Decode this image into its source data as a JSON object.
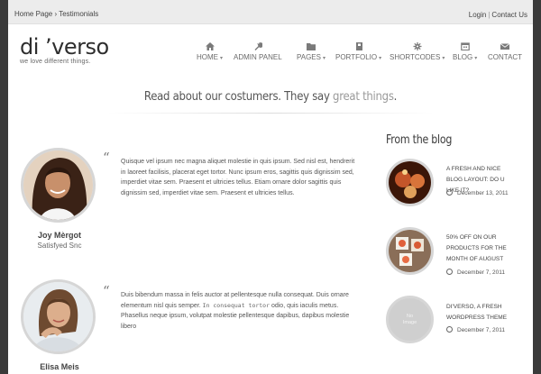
{
  "topbar": {
    "breadcrumb_home": "Home Page",
    "breadcrumb_separator": "›",
    "breadcrumb_current": "Testimonials",
    "login": "Login",
    "link_separator": "|",
    "contact": "Contact Us"
  },
  "logo": {
    "name": "di ’verso",
    "tagline": "we love different things."
  },
  "nav": [
    {
      "label": "HOME",
      "icon": "home-icon",
      "has_dropdown": true
    },
    {
      "label": "ADMIN PANEL",
      "icon": "wrench-icon",
      "has_dropdown": false
    },
    {
      "label": "PAGES",
      "icon": "folder-icon",
      "has_dropdown": true
    },
    {
      "label": "PORTFOLIO",
      "icon": "book-icon",
      "has_dropdown": true
    },
    {
      "label": "SHORTCODES",
      "icon": "gear-icon",
      "has_dropdown": true
    },
    {
      "label": "BLOG",
      "icon": "calendar-icon",
      "has_dropdown": true
    },
    {
      "label": "CONTACT",
      "icon": "mail-icon",
      "has_dropdown": false
    }
  ],
  "nav_caret": "▾",
  "banner": {
    "text": "Read about our costumers. They say ",
    "highlight": "great things",
    "end": "."
  },
  "quote_mark": "“",
  "testimonials": [
    {
      "text": "Quisque vel ipsum nec magna aliquet molestie in quis ipsum. Sed nisl est, hendrerit in laoreet facilisis, placerat eget tortor. Nunc ipsum eros, sagittis quis dignissim sed, imperdiet vitae sem. Praesent et ultricies tellus. Etiam ornare dolor sagittis quis dignissim sed, imperdiet vitae sem. Praesent et ultricies tellus.",
      "name": "Joy Mèrgot",
      "company": "Satisfyed Snc"
    },
    {
      "text_before": "Duis bibendum massa in felis auctor at pellentesque nulla consequat. Duis ornare elementum nisl quis semper. ",
      "text_code": "In consequat tortor",
      "text_after": " odio, quis iaculis metus. Phasellus neque ipsum, volutpat molestie pellentesque dapibus, dapibus molestie libero",
      "name": "Elisa Meis"
    }
  ],
  "blog": {
    "title": "From the blog",
    "posts": [
      {
        "title": "A fresh and nice blog layout: do u like it?",
        "date": "December 13, 2011"
      },
      {
        "title": "50% off on our products for the month of August",
        "date": "December 7, 2011"
      },
      {
        "title": "Di'verso, a fresh Wordpress theme",
        "date": "December 7, 2011",
        "thumb_label": "No Image"
      }
    ]
  },
  "colors": {
    "outer_background": "#3a3a3a",
    "topbar_background": "#ececec",
    "highlight_text": "#999999",
    "avatar_border": "#d6d6d6"
  }
}
